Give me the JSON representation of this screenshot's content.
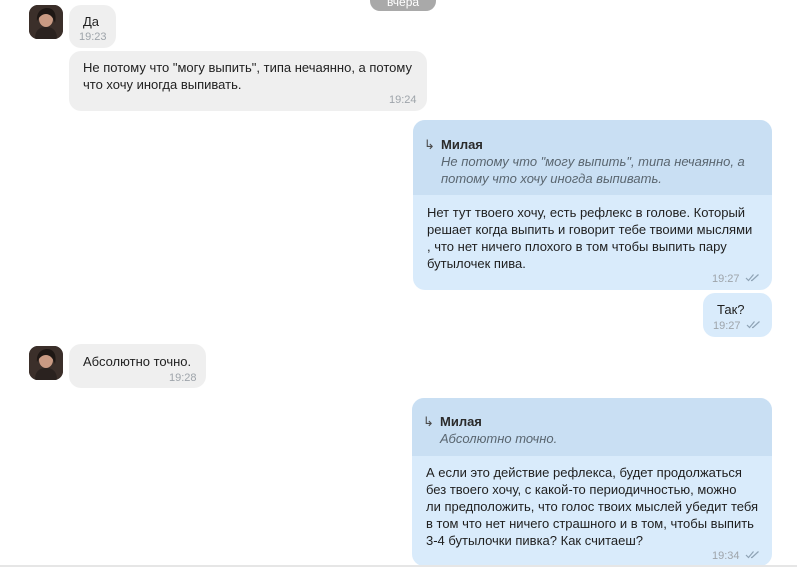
{
  "date_divider": "вчера",
  "messages": [
    {
      "text": "Да",
      "time": "19:23"
    },
    {
      "text": "Не потому что \"могу выпить\", типа нечаянно, а потому\nчто хочу иногда выпивать.",
      "time": "19:24"
    },
    {
      "quote_name": "Милая",
      "quote_text": "Не потому что \"могу выпить\", типа нечаянно, а\nпотому что хочу иногда выпивать.",
      "text": "Нет тут твоего хочу, есть рефлекс в голове. Который\nрешает когда выпить и говорит тебе твоими мыслями\n, что нет ничего плохого в том чтобы выпить пару\nбутылочек пива.",
      "time": "19:27"
    },
    {
      "text": "Так?",
      "time": "19:27"
    },
    {
      "text": "Абсолютно точно.",
      "time": "19:28"
    },
    {
      "quote_name": "Милая",
      "quote_text": "Абсолютно точно.",
      "text": "А если это действие рефлекса, будет продолжаться\nбез твоего хочу, с какой-то периодичностью, можно\nли предположить, что голос твоих мыслей убедит тебя\nв том что нет ничего страшного и в том, чтобы выпить\n3-4 бутылочки пивка? Как считаеш?",
      "time": "19:34"
    }
  ],
  "icons": {
    "reply_arrow": "↳",
    "read_status": "double-check-icon",
    "avatar": "contact-avatar"
  },
  "colors": {
    "incoming_bubble": "#efefef",
    "outgoing_bubble": "#d9ebfb",
    "quote_block": "#c9dff3",
    "date_pill": "#a9a9a9"
  }
}
